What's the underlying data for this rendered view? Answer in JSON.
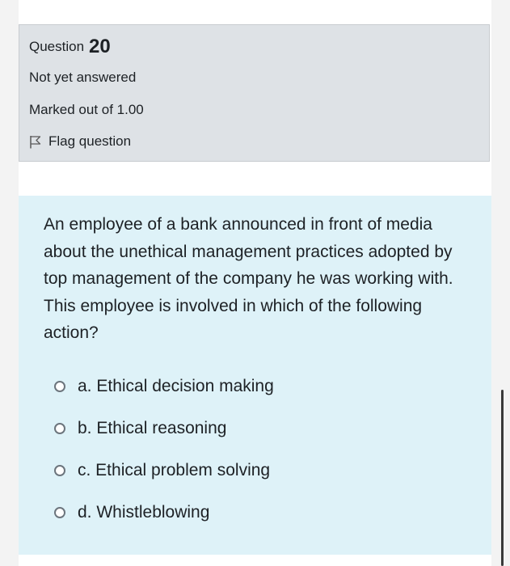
{
  "question": {
    "label": "Question",
    "number": "20",
    "state": "Not yet answered",
    "grade": "Marked out of 1.00",
    "flag_label": "Flag question",
    "text": "An employee of a bank announced in front of media about the unethical management practices adopted by top management of the company he was working with. This employee is involved in which of the following action?",
    "answers": [
      {
        "label": "a. Ethical decision making"
      },
      {
        "label": "b. Ethical reasoning"
      },
      {
        "label": "c. Ethical problem solving"
      },
      {
        "label": "d. Whistleblowing"
      }
    ]
  },
  "colors": {
    "info_panel_bg": "#dee2e6",
    "content_panel_bg": "#def2f8",
    "text": "#1d2125"
  },
  "icons": {
    "flag": "flag-outline-icon"
  }
}
